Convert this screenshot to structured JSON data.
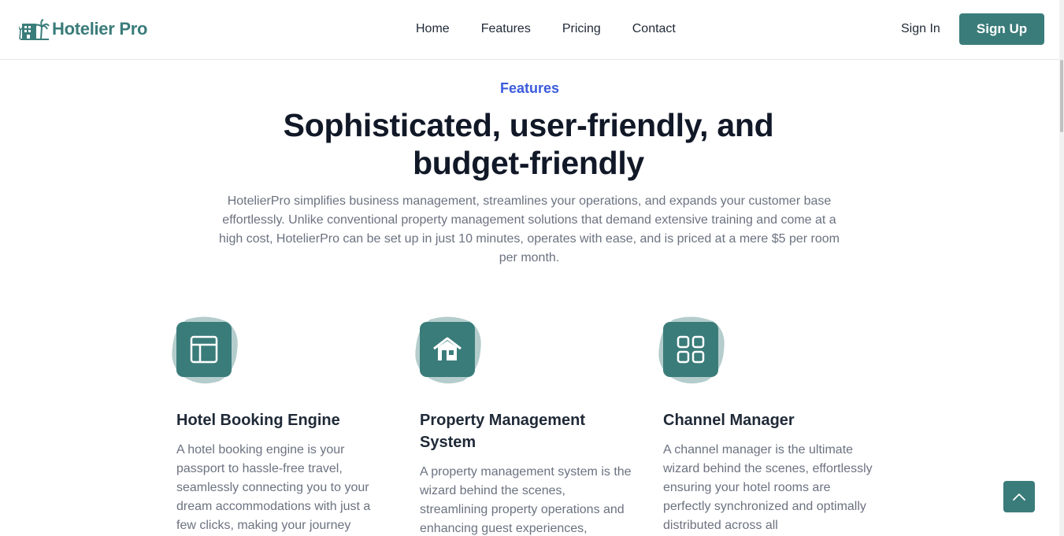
{
  "navbar": {
    "brand": "Hotelier Pro",
    "links": [
      {
        "label": "Home"
      },
      {
        "label": "Features"
      },
      {
        "label": "Pricing"
      },
      {
        "label": "Contact"
      }
    ],
    "signin_label": "Sign In",
    "signup_label": "Sign Up"
  },
  "hero": {
    "eyebrow": "Features",
    "headline_line1": "Sophisticated, user-friendly, and",
    "headline_line2": "budget-friendly",
    "description": "HotelierPro simplifies business management, streamlines your operations, and expands your customer base effortlessly. Unlike conventional property management solutions that demand extensive training and come at a high cost, HotelierPro can be set up in just 10 minutes, operates with ease, and is priced at a mere $5 per room per month."
  },
  "features": [
    {
      "icon": "layout-icon",
      "title": "Hotel Booking Engine",
      "description": "A hotel booking engine is your passport to hassle-free travel, seamlessly connecting you to your dream accommodations with just a few clicks, making your journey"
    },
    {
      "icon": "house-icon",
      "title": "Property Management System",
      "description": "A property management system is the wizard behind the scenes, streamlining property operations and enhancing guest experiences,"
    },
    {
      "icon": "grid-icon",
      "title": "Channel Manager",
      "description": "A channel manager is the ultimate wizard behind the scenes, effortlessly ensuring your hotel rooms are perfectly synchronized and optimally distributed across all"
    }
  ],
  "colors": {
    "brand": "#3a7c7a",
    "accent": "#3b5bdb",
    "heading": "#111827",
    "muted": "#6b7280"
  }
}
